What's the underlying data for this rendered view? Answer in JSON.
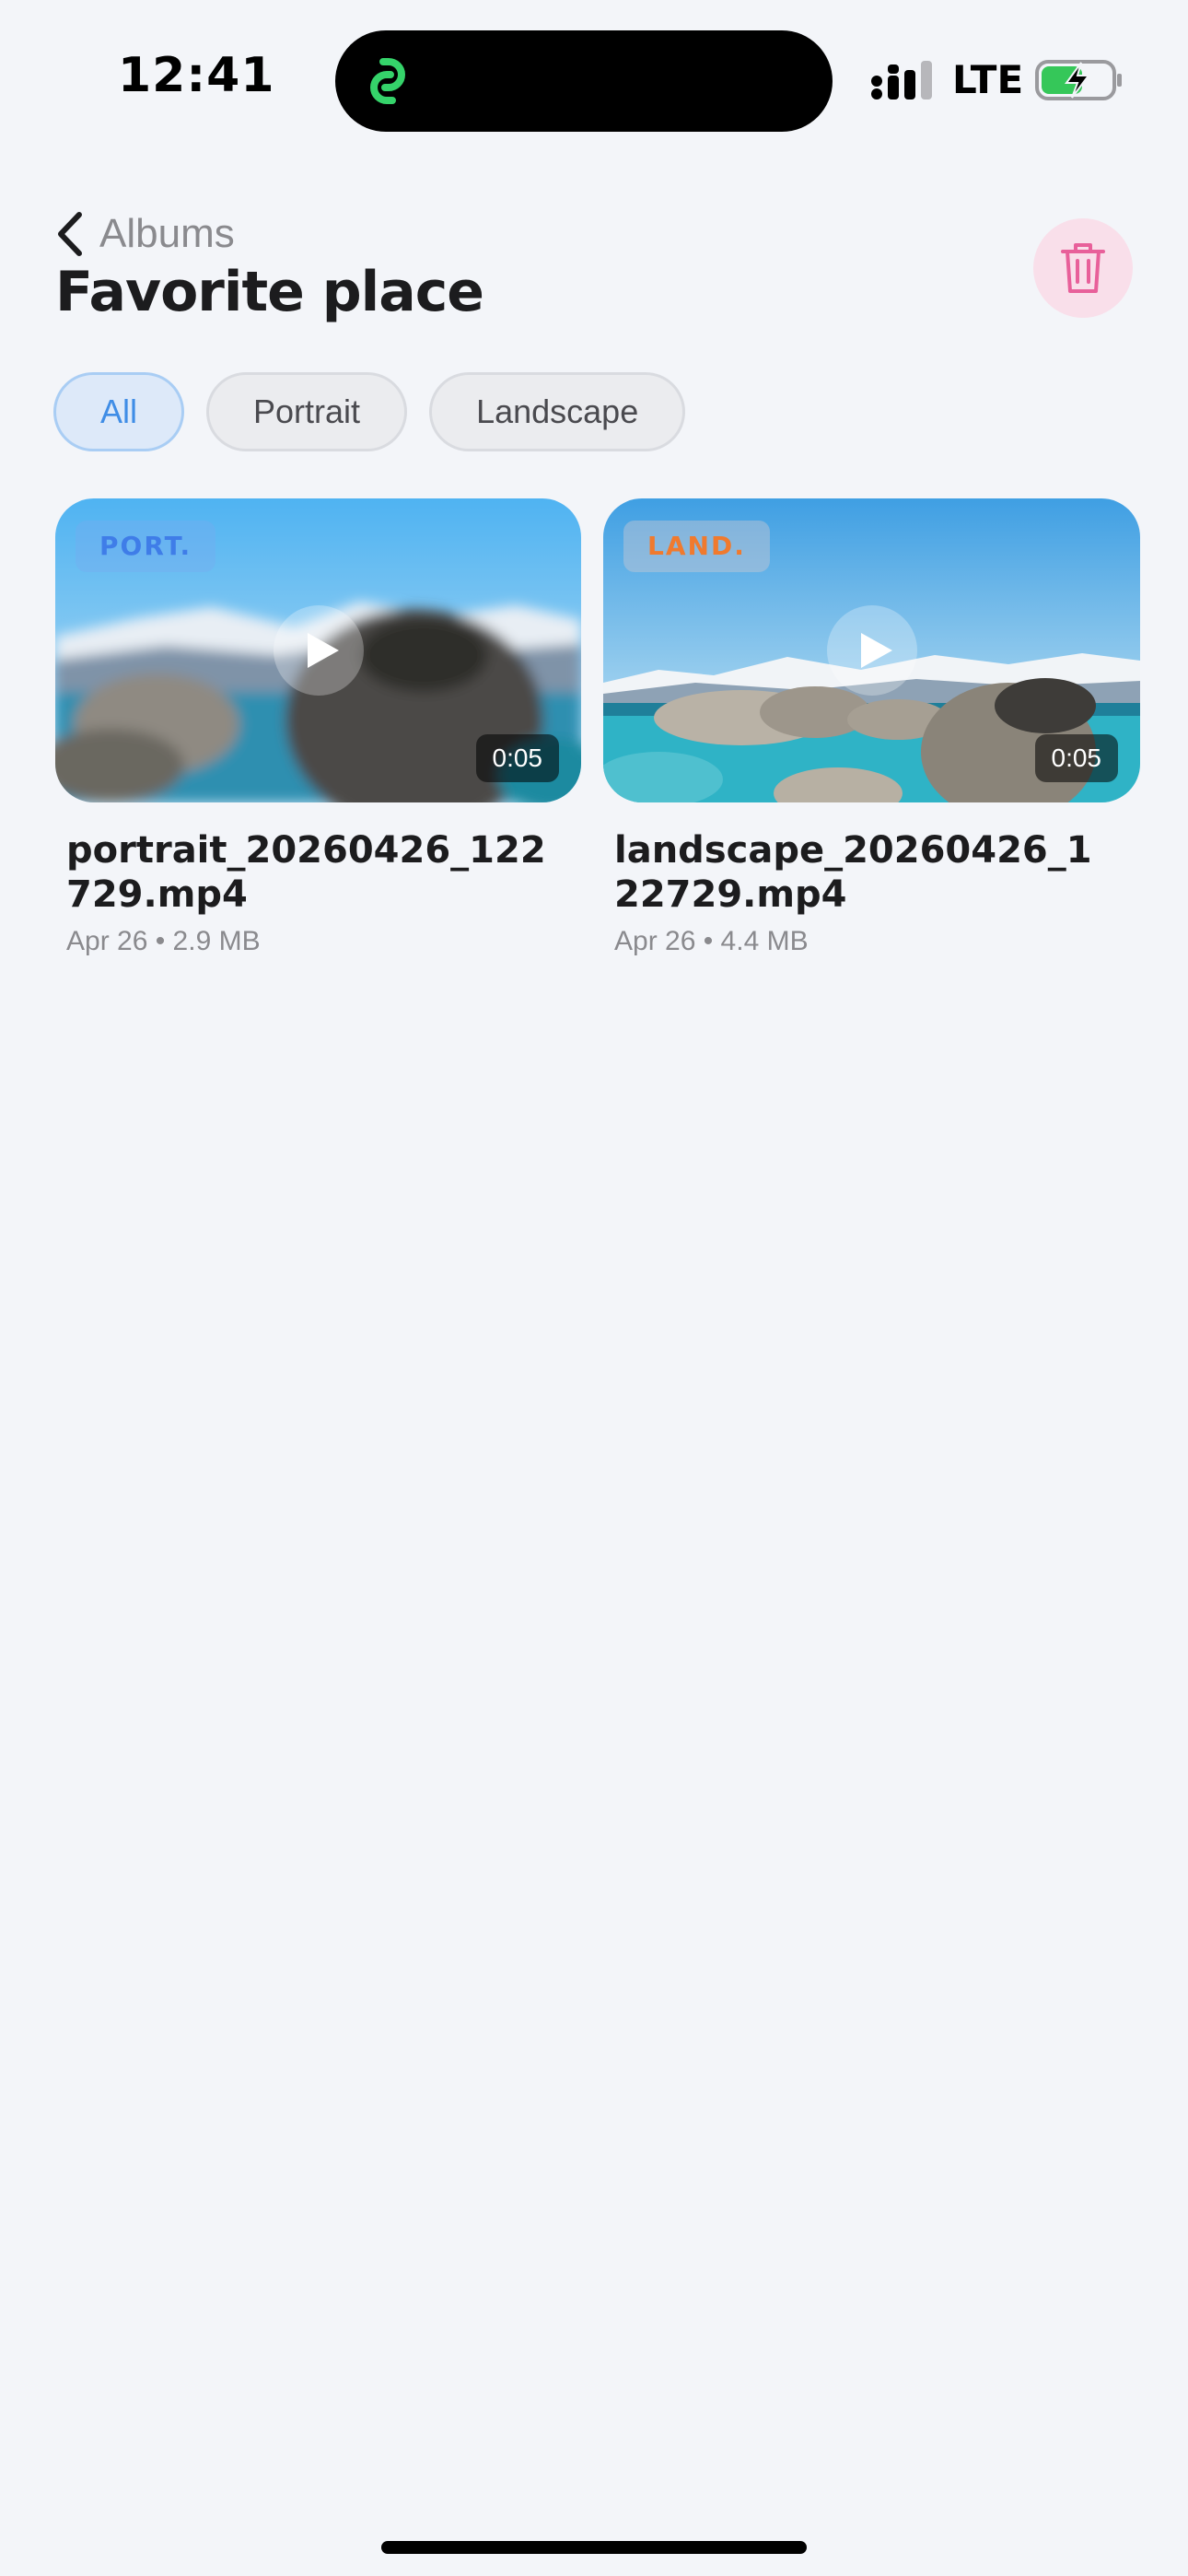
{
  "status_bar": {
    "time": "12:41",
    "network": "LTE",
    "icons": [
      "link-app-icon",
      "signal-icon",
      "battery-charging-icon"
    ]
  },
  "header": {
    "back_label": "Albums",
    "title": "Favorite place",
    "delete_icon": "trash-icon"
  },
  "filters": [
    {
      "label": "All",
      "active": true
    },
    {
      "label": "Portrait",
      "active": false
    },
    {
      "label": "Landscape",
      "active": false
    }
  ],
  "videos": [
    {
      "badge": "PORT.",
      "duration": "0:05",
      "filename": "portrait_20260426_122729.mp4",
      "date": "Apr 26",
      "size": "2.9 MB",
      "meta": "Apr 26 • 2.9 MB"
    },
    {
      "badge": "LAND.",
      "duration": "0:05",
      "filename": "landscape_20260426_122729.mp4",
      "date": "Apr 26",
      "size": "4.4 MB",
      "meta": "Apr 26 • 4.4 MB"
    }
  ],
  "colors": {
    "background": "#f3f5f9",
    "accent": "#3f8de6",
    "delete_bg": "#f9dfea",
    "delete_icon": "#e8609a",
    "island_icon": "#35d36a"
  }
}
